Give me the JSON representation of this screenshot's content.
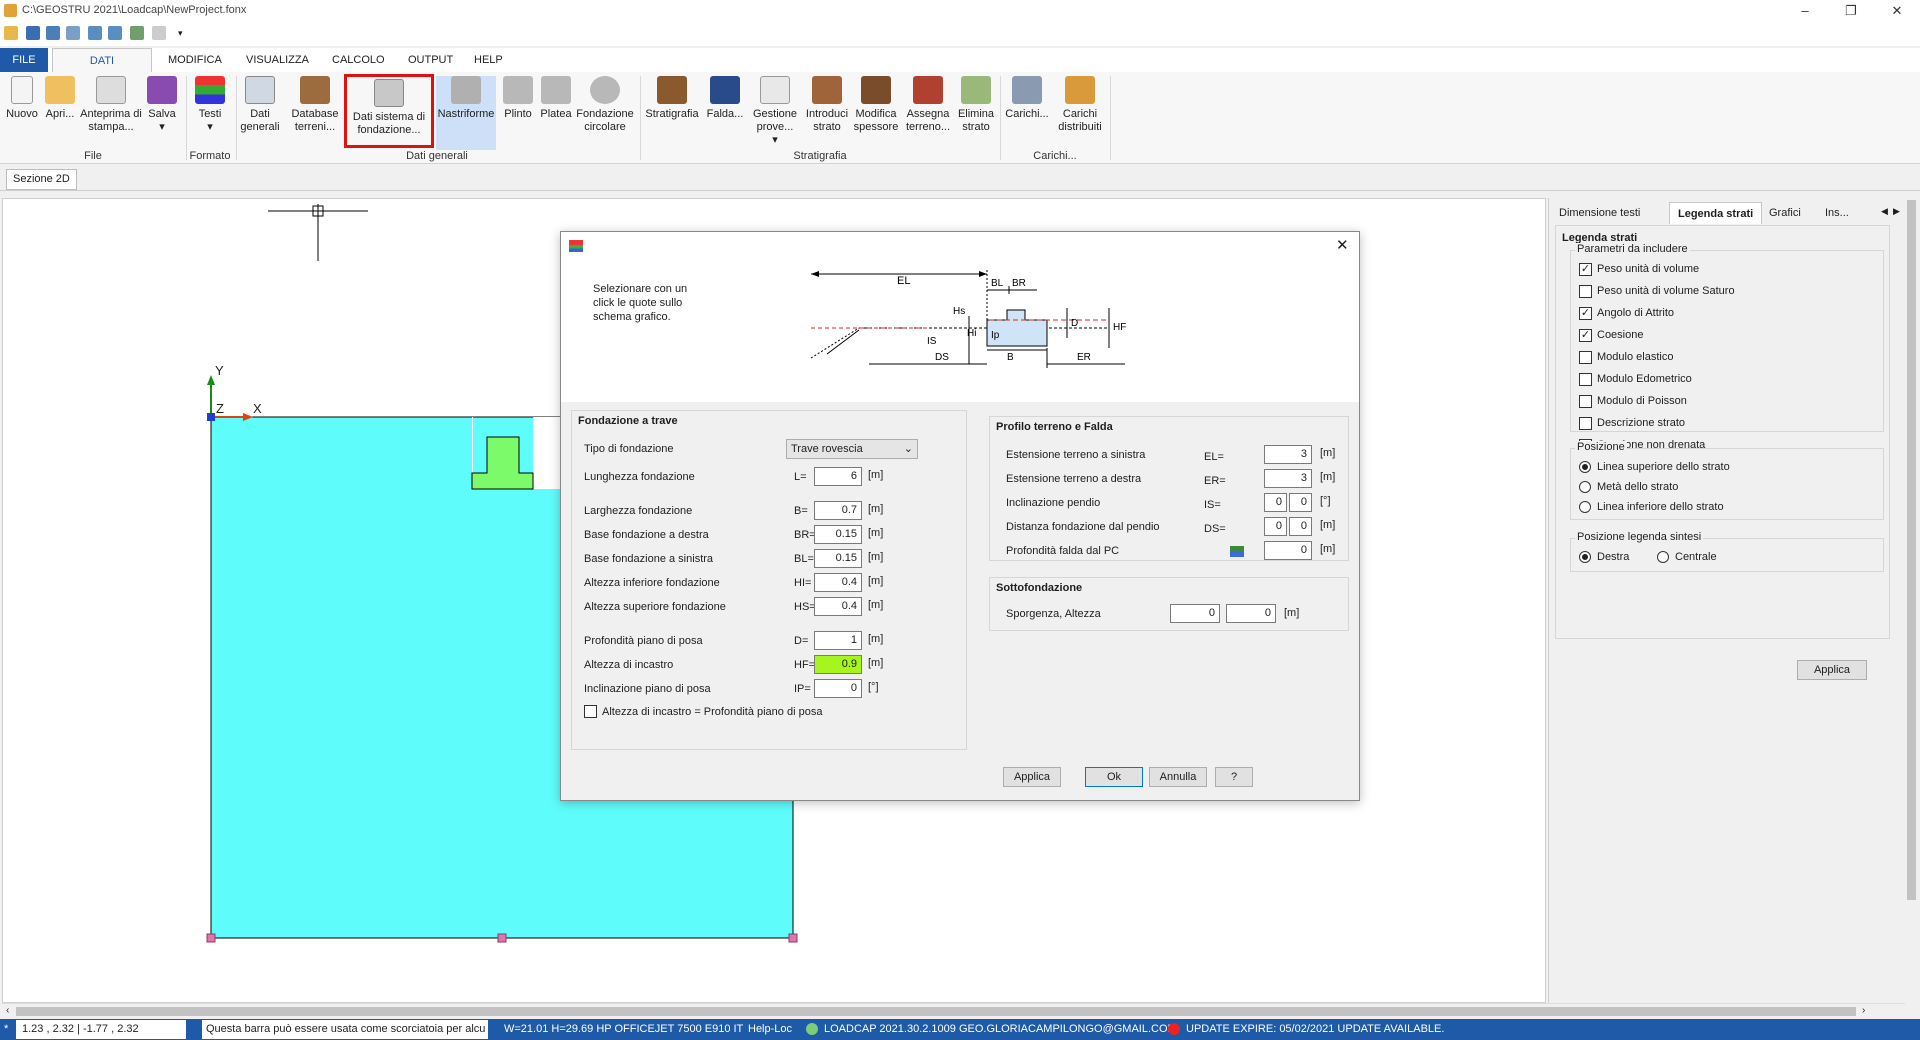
{
  "window": {
    "title": "C:\\GEOSTRU 2021\\Loadcap\\NewProject.fonx"
  },
  "menu": {
    "tabs": [
      "FILE",
      "DATI GENERALI",
      "MODIFICA",
      "VISUALIZZA",
      "CALCOLO",
      "OUTPUT",
      "HELP"
    ]
  },
  "ribbon": {
    "file": {
      "nuovo": "Nuovo",
      "apri": "Apri...",
      "anteprima": "Anteprima di stampa...",
      "salva": "Salva",
      "group": "File"
    },
    "formato": {
      "testi": "Testi",
      "group": "Formato"
    },
    "dati": {
      "dati_generali": "Dati generali",
      "database": "Database terreni...",
      "sistema": "Dati sistema di fondazione...",
      "nastriforme": "Nastriforme",
      "plinto": "Plinto",
      "platea": "Platea",
      "circolare": "Fondazione circolare",
      "group": "Dati generali"
    },
    "strat": {
      "stratigrafia": "Stratigrafia",
      "falda": "Falda...",
      "gestione": "Gestione prove...",
      "introduci": "Introduci strato",
      "modifica": "Modifica spessore",
      "assegna": "Assegna terreno...",
      "elimina": "Elimina strato",
      "group": "Stratigrafia"
    },
    "carichi": {
      "carichi": "Carichi...",
      "distribuiti": "Carichi distribuiti",
      "group": "Carichi..."
    }
  },
  "doc_tab": "Sezione 2D",
  "canvas": {
    "axis_y": "Y",
    "axis_z": "Z",
    "axis_x": "X"
  },
  "right_panel": {
    "tabs": [
      "Dimensione testi",
      "Legenda strati",
      "Grafici",
      "Ins..."
    ],
    "title": "Legenda strati",
    "params_title": "Parametri da includere",
    "params": [
      {
        "label": "Peso unità di volume",
        "checked": true
      },
      {
        "label": "Peso unità di volume Saturo",
        "checked": false
      },
      {
        "label": "Angolo di Attrito",
        "checked": true
      },
      {
        "label": "Coesione",
        "checked": true
      },
      {
        "label": "Modulo elastico",
        "checked": false
      },
      {
        "label": "Modulo Edometrico",
        "checked": false
      },
      {
        "label": "Modulo di Poisson",
        "checked": false
      },
      {
        "label": "Descrizione strato",
        "checked": false
      },
      {
        "label": "Coesione non drenata",
        "checked": false
      }
    ],
    "pos_title": "Posizione",
    "positions": [
      {
        "label": "Linea superiore dello strato",
        "on": true
      },
      {
        "label": "Metà dello strato",
        "on": false
      },
      {
        "label": "Linea inferiore dello strato",
        "on": false
      }
    ],
    "legend_pos_title": "Posizione legenda sintesi",
    "legend_pos": [
      {
        "label": "Destra",
        "on": true
      },
      {
        "label": "Centrale",
        "on": false
      }
    ],
    "apply": "Applica"
  },
  "dialog": {
    "hint": "Selezionare con un click le quote sullo schema grafico.",
    "schema": {
      "EL": "EL",
      "BL": "BL",
      "BR": "BR",
      "Hs": "Hs",
      "Hi": "Hi",
      "IS": "IS",
      "DS": "DS",
      "Ip": "Ip",
      "B": "B",
      "D": "D",
      "HF": "HF",
      "ER": "ER"
    },
    "left_title": "Fondazione a trave",
    "tipo_label": "Tipo di fondazione",
    "tipo_value": "Trave rovescia",
    "fields": [
      {
        "label": "Lunghezza fondazione",
        "sym": "L=",
        "value": "6",
        "unit": "[m]"
      },
      {
        "label": "Larghezza fondazione",
        "sym": "B=",
        "value": "0.7",
        "unit": "[m]"
      },
      {
        "label": "Base fondazione a destra",
        "sym": "BR=",
        "value": "0.15",
        "unit": "[m]"
      },
      {
        "label": "Base fondazione a sinistra",
        "sym": "BL=",
        "value": "0.15",
        "unit": "[m]"
      },
      {
        "label": "Altezza inferiore fondazione",
        "sym": "HI=",
        "value": "0.4",
        "unit": "[m]"
      },
      {
        "label": "Altezza superiore fondazione",
        "sym": "HS=",
        "value": "0.4",
        "unit": "[m]"
      },
      {
        "label": "Profondità piano di posa",
        "sym": "D=",
        "value": "1",
        "unit": "[m]"
      },
      {
        "label": "Altezza di incastro",
        "sym": "HF=",
        "value": "0.9",
        "unit": "[m]"
      },
      {
        "label": "Inclinazione piano di posa",
        "sym": "IP=",
        "value": "0",
        "unit": "[°]"
      }
    ],
    "chk_label": "Altezza di incastro = Profondità piano di posa",
    "right_title": "Profilo terreno e Falda",
    "profile": [
      {
        "label": "Estensione terreno a sinistra",
        "sym": "EL=",
        "value": "3",
        "unit": "[m]"
      },
      {
        "label": "Estensione terreno a destra",
        "sym": "ER=",
        "value": "3",
        "unit": "[m]"
      },
      {
        "label": "Inclinazione pendio",
        "sym": "IS=",
        "v1": "0",
        "v2": "0",
        "unit": "[°]"
      },
      {
        "label": "Distanza fondazione dal pendio",
        "sym": "DS=",
        "v1": "0",
        "v2": "0",
        "unit": "[m]"
      },
      {
        "label": "Profondità falda dal PC",
        "sym": "",
        "value": "0",
        "unit": "[m]"
      }
    ],
    "sotto_title": "Sottofondazione",
    "sotto_label": "Sporgenza, Altezza",
    "sotto_v1": "0",
    "sotto_v2": "0",
    "sotto_unit": "[m]",
    "buttons": {
      "applica": "Applica",
      "ok": "Ok",
      "annulla": "Annulla",
      "help": "?"
    }
  },
  "status": {
    "coords": "1.23 , 2.32 | -1.77 , 2.32",
    "hint": "Questa barra può essere usata come scorciatoia per alcuni",
    "printer": "W=21.01 H=29.69 HP OFFICEJET 7500 E910  IT",
    "help": "Help-Loc",
    "version": "LOADCAP 2021.30.2.1009 GEO.GLORIACAMPILONGO@GMAIL.COM",
    "update": "UPDATE EXPIRE: 05/02/2021 UPDATE AVAILABLE."
  }
}
